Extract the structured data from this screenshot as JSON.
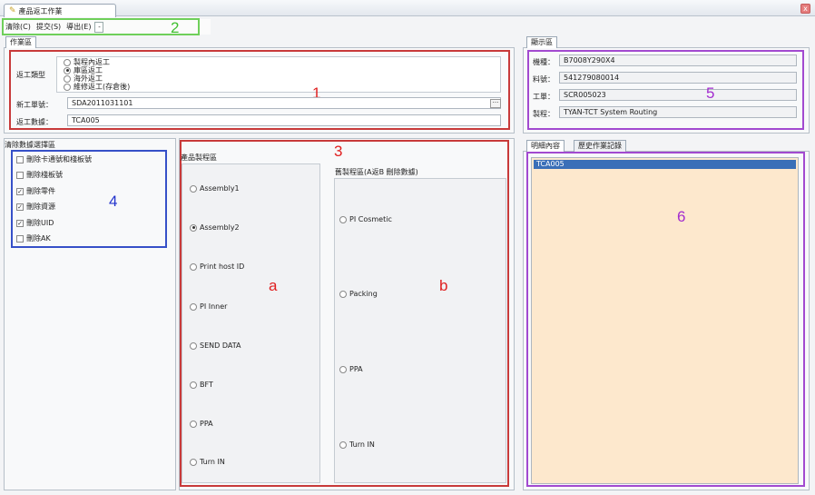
{
  "window": {
    "tab_title": "產品返工作業",
    "close_label": "x"
  },
  "toolbar": {
    "clear_label": "清除(C)",
    "submit_label": "提交(S)",
    "export_label": "導出(E)",
    "dropdown_label": "-"
  },
  "work_area": {
    "tab_label": "作業區",
    "rework_type_label": "返工類型",
    "rework_options": [
      {
        "label": "製程內返工",
        "selected": false
      },
      {
        "label": "庫區返工",
        "selected": true
      },
      {
        "label": "海外返工",
        "selected": false
      },
      {
        "label": "維修返工(存倉後)",
        "selected": false
      }
    ],
    "new_order_label": "新工單號：",
    "new_order_value": "SDA2011031101",
    "rework_data_label": "返工數據：",
    "rework_data_value": "TCA005",
    "browse_label": "···"
  },
  "display_area": {
    "tab_label": "顯示區",
    "fields": [
      {
        "label": "機種：",
        "value": "B7008Y290X4"
      },
      {
        "label": "料號：",
        "value": "541279080014"
      },
      {
        "label": "工單：",
        "value": "SCR005023"
      },
      {
        "label": "製程：",
        "value": "TYAN-TCT System Routing"
      }
    ]
  },
  "clear_data": {
    "title": "清除數據選擇區",
    "options": [
      {
        "label": "刪除卡通號和棧板號",
        "checked": false
      },
      {
        "label": "刪除棧板號",
        "checked": false
      },
      {
        "label": "刪除零件",
        "checked": true
      },
      {
        "label": "刪除資源",
        "checked": true
      },
      {
        "label": "刪除UID",
        "checked": true
      },
      {
        "label": "刪除AK",
        "checked": false
      }
    ]
  },
  "process_area": {
    "product_title": "產品製程區",
    "product_routes": [
      {
        "label": "Assembly1",
        "selected": false
      },
      {
        "label": "Assembly2",
        "selected": true
      },
      {
        "label": "Print host ID",
        "selected": false
      },
      {
        "label": "PI Inner",
        "selected": false
      },
      {
        "label": "SEND DATA",
        "selected": false
      },
      {
        "label": "BFT",
        "selected": false
      },
      {
        "label": "PPA",
        "selected": false
      },
      {
        "label": "Turn IN",
        "selected": false
      }
    ],
    "old_title": "舊製程區(A返B 刪除數據)",
    "old_routes": [
      {
        "label": "PI Cosmetic",
        "selected": false
      },
      {
        "label": "Packing",
        "selected": false
      },
      {
        "label": "PPA",
        "selected": false
      },
      {
        "label": "Turn IN",
        "selected": false
      }
    ]
  },
  "detail_area": {
    "tabs": [
      "明細內容",
      "歷史作業記錄"
    ],
    "items": [
      "TCA005"
    ]
  },
  "annotations": {
    "n1": "1",
    "n2": "2",
    "n3": "3",
    "n4": "4",
    "n5": "5",
    "n6": "6",
    "a": "a",
    "b": "b"
  },
  "colors": {
    "annotation_red": "#e02020",
    "annotation_green": "#3fbf2f",
    "annotation_blue": "#2233cc",
    "annotation_purple": "#a32ccf",
    "list_background": "#fde8cd",
    "selection": "#3a6fb8"
  }
}
